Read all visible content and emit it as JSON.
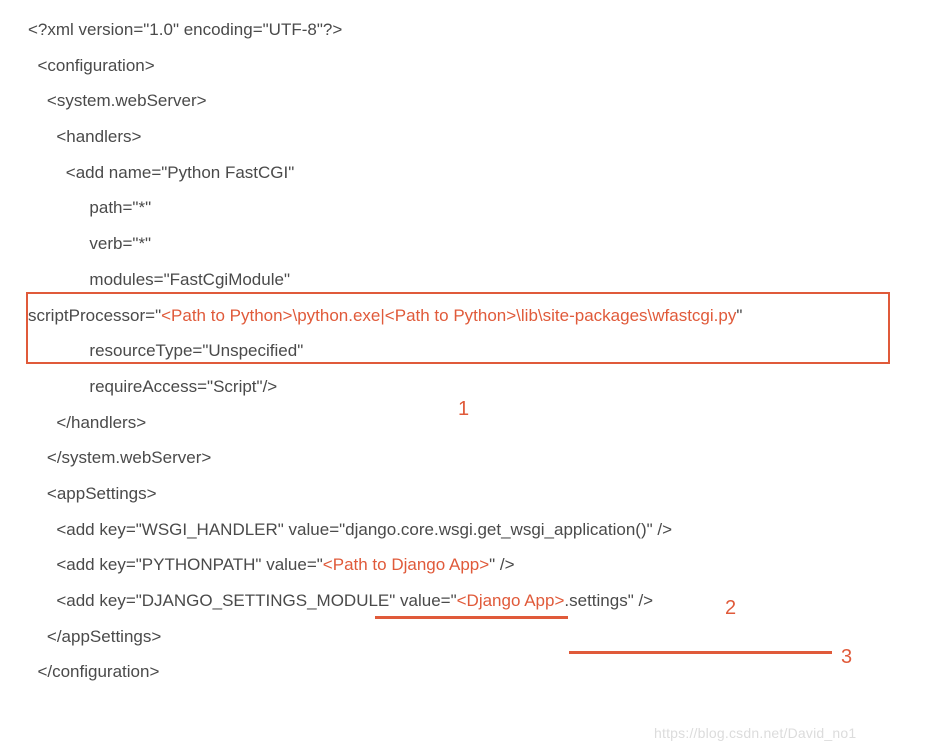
{
  "lines": {
    "l1": "<?xml version=\"1.0\" encoding=\"UTF-8\"?>",
    "l2": "<configuration>",
    "l3": "<system.webServer>",
    "l4": "<handlers>",
    "l5": "<add name=\"Python FastCGI\"",
    "l6": "path=\"*\"",
    "l7": "verb=\"*\"",
    "l8": "modules=\"FastCgiModule\"",
    "l9a": "scriptProcessor=\"",
    "l9b": "<Path to Python>\\python.exe|<Path to Python>\\lib\\site-packages\\wfastcgi.py",
    "l9c": "\"",
    "l10": "resourceType=\"Unspecified\"",
    "l11": "requireAccess=\"Script\"/>",
    "l12": "</handlers>",
    "l13": "</system.webServer>",
    "l14": "<appSettings>",
    "l15": "<add key=\"WSGI_HANDLER\" value=\"django.core.wsgi.get_wsgi_application()\" />",
    "l16a": "<add key=\"PYTHONPATH\" value=\"",
    "l16b": "<Path to Django App>",
    "l16c": "\" />",
    "l17a": "<add key=\"DJANGO_SETTINGS_MODULE\" value=\"",
    "l17b": "<Django App>",
    "l17c": ".settings\" />",
    "l18": "</appSettings>",
    "l19": "</configuration>"
  },
  "annotations": {
    "n1": "1",
    "n2": "2",
    "n3": "3"
  },
  "watermark": "https://blog.csdn.net/David_no1",
  "colors": {
    "highlight": "#e05a3a",
    "text": "#4a4a4a"
  }
}
